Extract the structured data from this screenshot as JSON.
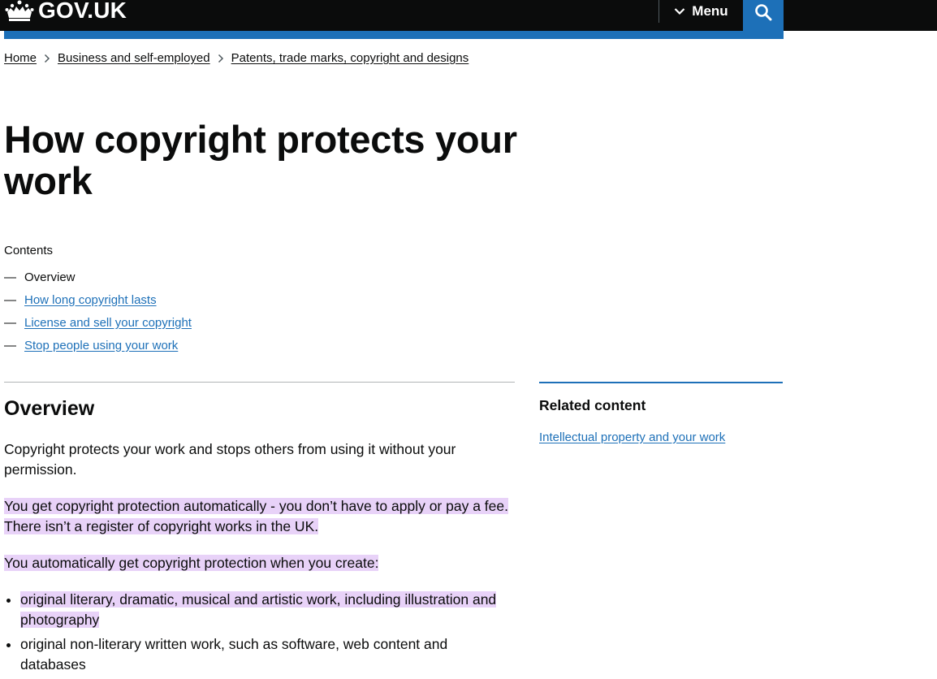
{
  "header": {
    "logo_text": "GOV.UK",
    "menu_label": "Menu"
  },
  "breadcrumbs": [
    "Home",
    "Business and self-employed",
    "Patents, trade marks, copyright and designs"
  ],
  "page_title": "How copyright protects your work",
  "contents": {
    "label": "Contents",
    "items": [
      {
        "label": "Overview",
        "dash": "—"
      },
      {
        "label": "How long copyright lasts",
        "dash": "—"
      },
      {
        "label": "License and sell your copyright",
        "dash": "—"
      },
      {
        "label": "Stop people using your work",
        "dash": "—"
      }
    ]
  },
  "section": {
    "heading": "Overview",
    "paragraphs": [
      "Copyright protects your work and stops others from using it without your permission.",
      "You get copyright protection automatically - you don’t have to apply or pay a fee. There isn’t a register of copyright works in the UK.",
      "You automatically get copyright protection when you create:"
    ],
    "list": [
      "original literary, dramatic, musical and artistic work, including illustration and photography",
      "original non-literary written work, such as software, web content and databases"
    ]
  },
  "related": {
    "heading": "Related content",
    "link": "Intellectual property and your work"
  },
  "colors": {
    "header_bg": "#0b0c0c",
    "brand_blue": "#1d70b8",
    "link": "#1d70b8",
    "highlight": "#e8d2f8"
  },
  "icons": [
    "crown-icon",
    "chevron-down-icon",
    "search-icon",
    "chevron-right-icon"
  ]
}
